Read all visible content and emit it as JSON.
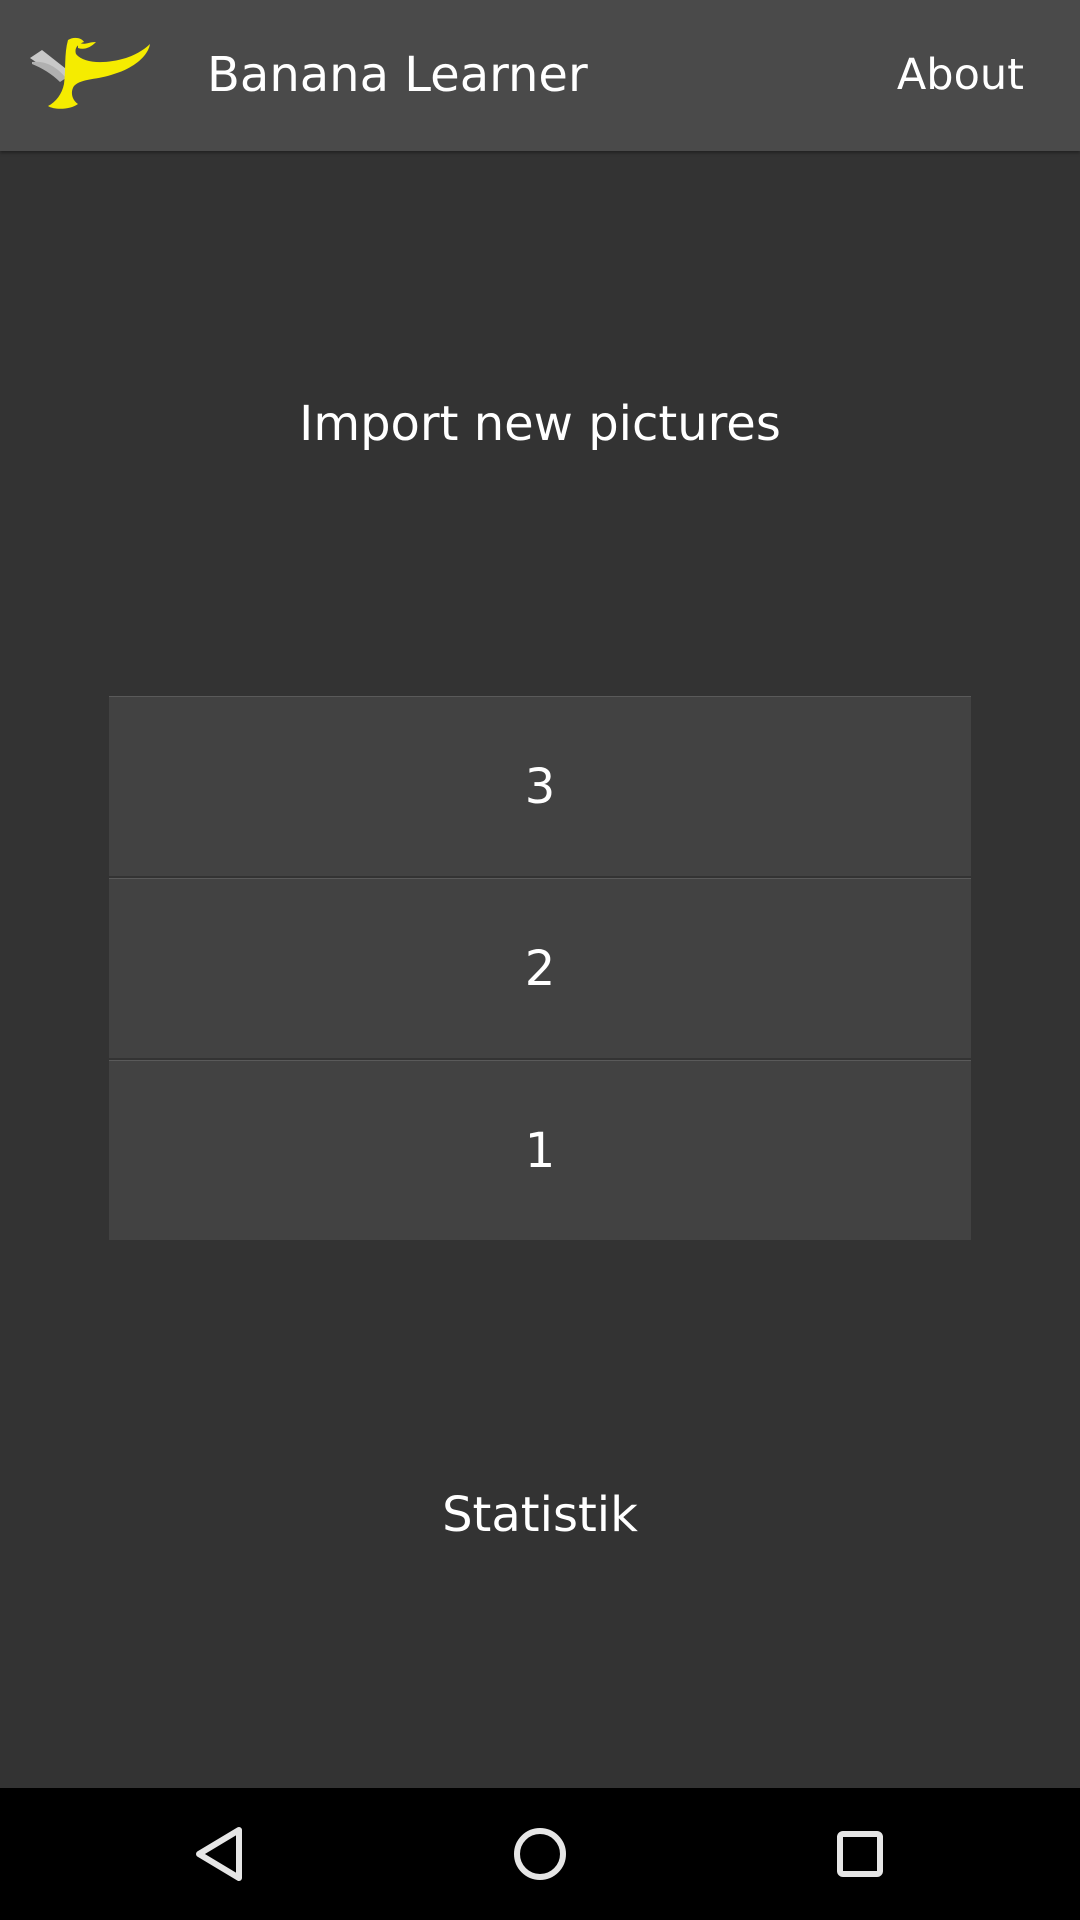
{
  "action_bar": {
    "logo_icon": "banana-logo-icon",
    "title": "Banana Learner",
    "about_label": "About",
    "colors": {
      "background": "#4a4a4a",
      "logo_yellow": "#f5ec00",
      "logo_grey": "#c8c8c8"
    }
  },
  "main": {
    "import_label": "Import new pictures",
    "levels": [
      {
        "label": "3"
      },
      {
        "label": "2"
      },
      {
        "label": "1"
      }
    ],
    "statistics_label": "Statistik",
    "colors": {
      "background": "#333333",
      "button_background": "#424242"
    }
  },
  "nav_bar": {
    "icons": [
      "back-icon",
      "home-icon",
      "recents-icon"
    ],
    "background": "#000000"
  }
}
